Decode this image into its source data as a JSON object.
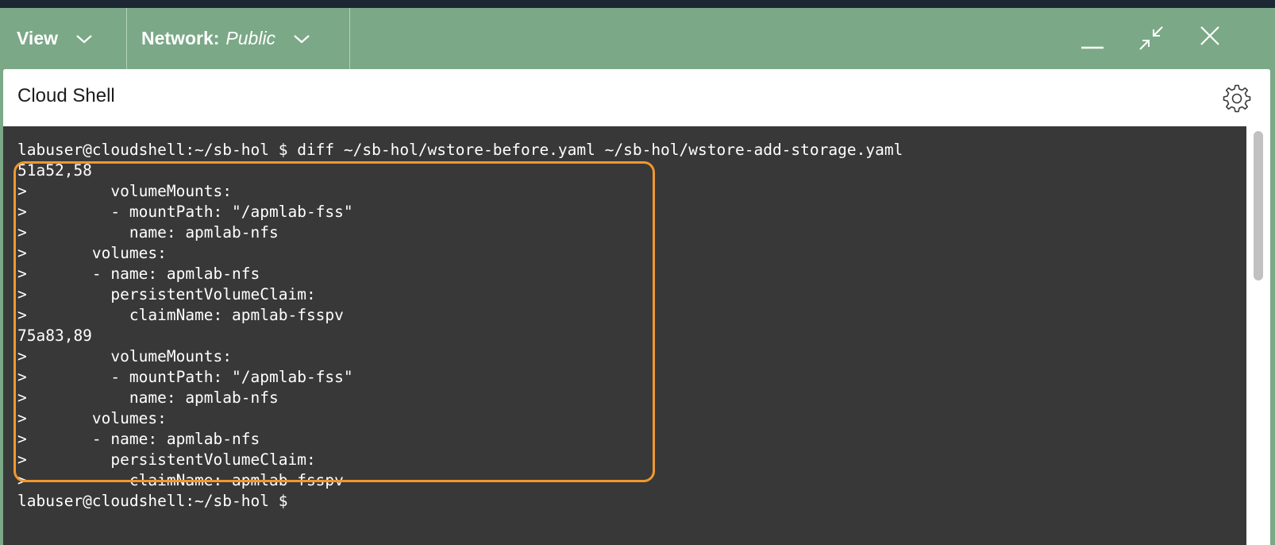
{
  "toolbar": {
    "view_label": "View",
    "network_label": "Network:",
    "network_value": "Public",
    "minimize_icon": "minimize-icon",
    "restore_icon": "collapse-arrows-icon",
    "close_icon": "close-icon",
    "background_color": "#7ba886"
  },
  "panel": {
    "title": "Cloud Shell",
    "settings_icon": "gear-icon"
  },
  "terminal": {
    "background_color": "#383838",
    "highlight_color": "#f0982e",
    "lines": [
      "labuser@cloudshell:~/sb-hol $ diff ~/sb-hol/wstore-before.yaml ~/sb-hol/wstore-add-storage.yaml",
      "51a52,58",
      ">         volumeMounts:",
      ">         - mountPath: \"/apmlab-fss\"",
      ">           name: apmlab-nfs",
      ">       volumes:",
      ">       - name: apmlab-nfs",
      ">         persistentVolumeClaim:",
      ">           claimName: apmlab-fsspv",
      "75a83,89",
      ">         volumeMounts:",
      ">         - mountPath: \"/apmlab-fss\"",
      ">           name: apmlab-nfs",
      ">       volumes:",
      ">       - name: apmlab-nfs",
      ">         persistentVolumeClaim:",
      ">           claimName: apmlab-fsspv",
      "labuser@cloudshell:~/sb-hol $"
    ]
  }
}
